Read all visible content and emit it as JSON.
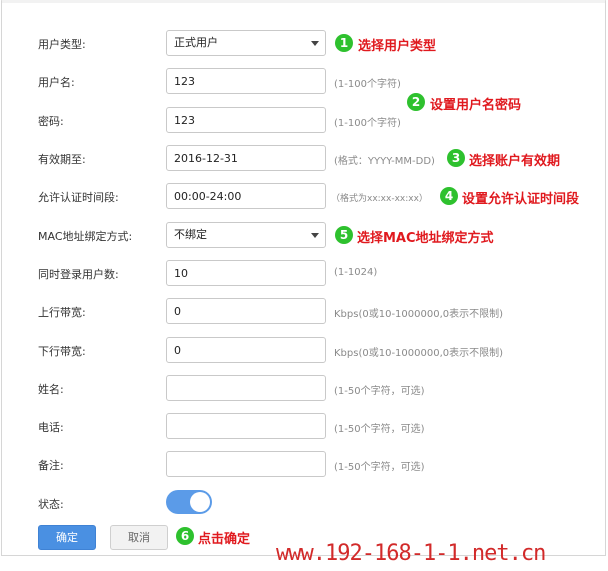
{
  "form": {
    "rows": [
      {
        "label": "用户类型:",
        "value": "正式用户",
        "type": "select"
      },
      {
        "label": "用户名:",
        "value": "123",
        "hint": "(1-100个字符)"
      },
      {
        "label": "密码:",
        "value": "123",
        "hint": "(1-100个字符)"
      },
      {
        "label": "有效期至:",
        "value": "2016-12-31",
        "hint": "(格式：YYYY-MM-DD)"
      },
      {
        "label": "允许认证时间段:",
        "value": "00:00-24:00",
        "hint": "（格式为xx:xx-xx:xx）"
      },
      {
        "label": "MAC地址绑定方式:",
        "value": "不绑定",
        "type": "select"
      },
      {
        "label": "同时登录用户数:",
        "value": "10",
        "hint": "(1-1024)"
      },
      {
        "label": "上行带宽:",
        "value": "0",
        "hint": "Kbps(0或10-1000000,0表示不限制)"
      },
      {
        "label": "下行带宽:",
        "value": "0",
        "hint": "Kbps(0或10-1000000,0表示不限制)"
      },
      {
        "label": "姓名:",
        "value": "",
        "hint": "(1-50个字符，可选)"
      },
      {
        "label": "电话:",
        "value": "",
        "hint": "(1-50个字符，可选)"
      },
      {
        "label": "备注:",
        "value": "",
        "hint": "(1-50个字符，可选)"
      }
    ],
    "status_label": "状态:",
    "status_on": true,
    "confirm_label": "确定",
    "cancel_label": "取消"
  },
  "annotations": [
    {
      "num": "1",
      "text": "选择用户类型"
    },
    {
      "num": "2",
      "text": "设置用户名密码"
    },
    {
      "num": "3",
      "text": "选择账户有效期"
    },
    {
      "num": "4",
      "text": "设置允许认证时间段"
    },
    {
      "num": "5",
      "text": "选择MAC地址绑定方式"
    },
    {
      "num": "6",
      "text": "点击确定"
    }
  ],
  "watermark": "www.192-168-1-1.net.cn",
  "colors": {
    "accent": "#4a90e2",
    "toggle_on": "#5b9be8",
    "badge": "#2ec12e",
    "note": "#e0191e",
    "watermark": "#d22a2a"
  }
}
